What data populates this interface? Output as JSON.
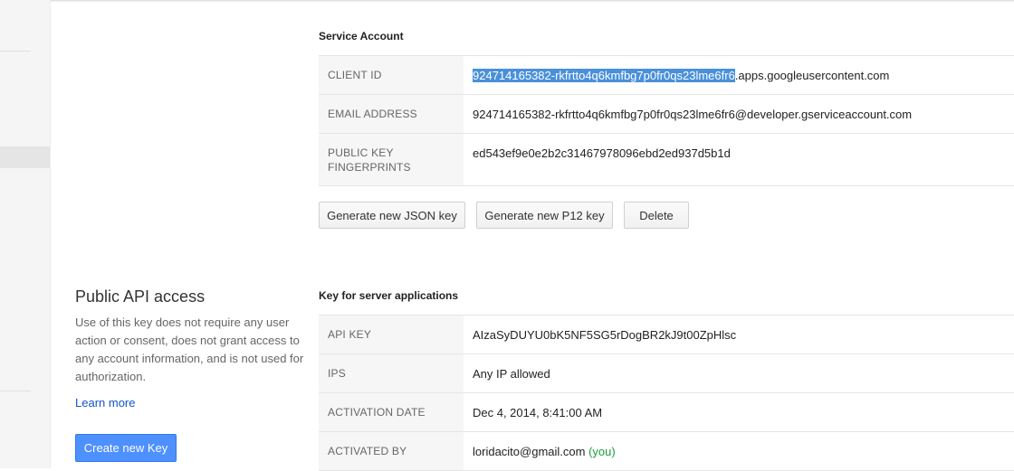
{
  "service_account": {
    "heading": "Service Account",
    "rows": [
      {
        "label": "CLIENT ID",
        "value_highlight": "924714165382-rkfrtto4q6kmfbg7p0fr0qs23lme6fr6",
        "value_rest": ".apps.googleusercontent.com"
      },
      {
        "label": "EMAIL ADDRESS",
        "value": "924714165382-rkfrtto4q6kmfbg7p0fr0qs23lme6fr6@developer.gserviceaccount.com"
      },
      {
        "label_line1": "PUBLIC KEY",
        "label_line2": "FINGERPRINTS",
        "value": "ed543ef9e0e2b2c31467978096ebd2ed937d5b1d"
      }
    ],
    "buttons": {
      "json_key": "Generate new JSON key",
      "p12_key": "Generate new P12 key",
      "delete": "Delete"
    }
  },
  "public_api": {
    "title": "Public API access",
    "description": "Use of this key does not require any user action or consent, does not grant access to any account information, and is not used for authorization.",
    "learn_more": "Learn more",
    "create_key": "Create new Key"
  },
  "server_key": {
    "heading": "Key for server applications",
    "rows": [
      {
        "label": "API KEY",
        "value": "AIzaSyDUYU0bK5NF5SG5rDogBR2kJ9t00ZpHlsc"
      },
      {
        "label": "IPS",
        "value": "Any IP allowed"
      },
      {
        "label": "ACTIVATION DATE",
        "value": "Dec 4, 2014, 8:41:00 AM"
      },
      {
        "label": "ACTIVATED BY",
        "value": "loridacito@gmail.com",
        "suffix": "(you)"
      }
    ]
  },
  "colors": {
    "primary_button": "#4d90fe",
    "link": "#1155cc",
    "selection": "#4a90d9",
    "you_tag": "#1c9e3c"
  }
}
